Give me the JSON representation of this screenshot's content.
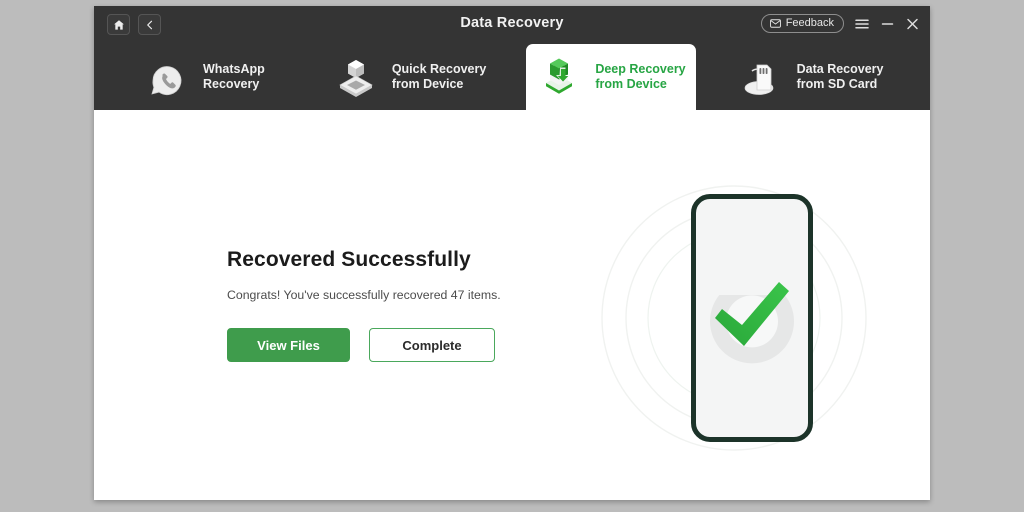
{
  "window": {
    "title": "Data Recovery",
    "titlebar": {
      "home_icon": "home-icon",
      "back_icon": "back-chevron-icon",
      "feedback_label": "Feedback",
      "feedback_icon": "envelope-icon",
      "menu_icon": "hamburger-menu-icon",
      "minimize_icon": "minimize-icon",
      "close_icon": "close-icon"
    },
    "colors": {
      "titlebar_bg": "#343434",
      "desktop_bg": "#bcbcbc",
      "accent_green": "#3f9c4c",
      "tab_active_text": "#27a544",
      "check_green": "#2eb943",
      "phone_border": "#1c3329"
    }
  },
  "tabs": [
    {
      "id": "whatsapp-recovery",
      "line1": "WhatsApp",
      "line2": "Recovery",
      "icon": "whatsapp-phone-bubble-icon",
      "active": false
    },
    {
      "id": "quick-recovery-from-device",
      "line1": "Quick Recovery",
      "line2": "from Device",
      "icon": "cube-on-plate-icon",
      "active": false
    },
    {
      "id": "deep-recovery-from-device",
      "line1": "Deep Recovery",
      "line2": "from Device",
      "icon": "green-cube-download-icon",
      "active": true
    },
    {
      "id": "data-recovery-from-sd-card",
      "line1": "Data Recovery",
      "line2": "from SD Card",
      "icon": "sd-card-icon",
      "active": false
    }
  ],
  "main": {
    "headline": "Recovered Successfully",
    "subline": "Congrats! You've successfully recovered 47 items.",
    "recovered_count": 47,
    "buttons": {
      "primary": "View Files",
      "secondary": "Complete"
    },
    "illustration": {
      "name": "phone-with-green-checkmark",
      "check_icon": "checkmark-icon"
    }
  }
}
